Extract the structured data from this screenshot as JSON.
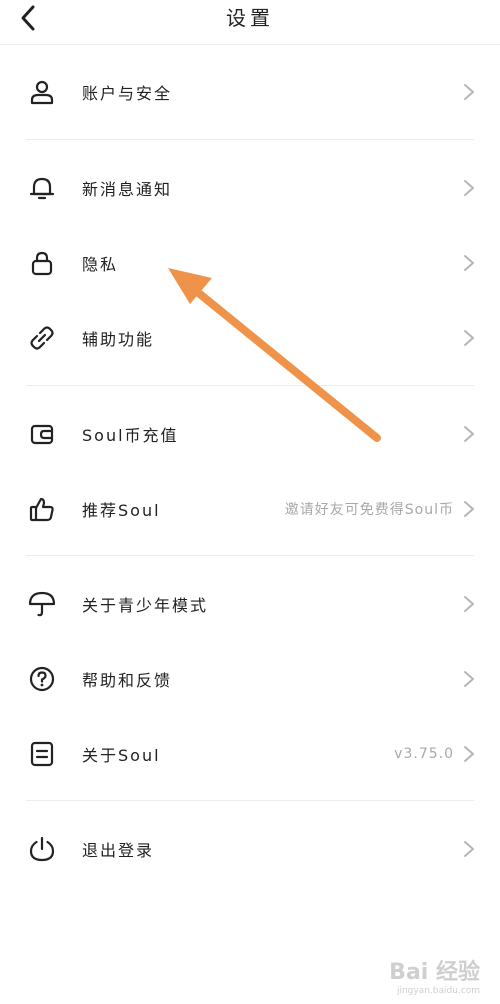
{
  "header": {
    "title": "设置",
    "back_icon": "chevron-left-icon"
  },
  "groups": [
    {
      "items": [
        {
          "label": "账户与安全",
          "icon": "user-icon",
          "hint": ""
        }
      ]
    },
    {
      "items": [
        {
          "label": "新消息通知",
          "icon": "bell-icon",
          "hint": ""
        },
        {
          "label": "隐私",
          "icon": "lock-icon",
          "hint": ""
        },
        {
          "label": "辅助功能",
          "icon": "link-icon",
          "hint": ""
        }
      ]
    },
    {
      "items": [
        {
          "label": "Soul币充值",
          "icon": "wallet-icon",
          "hint": ""
        },
        {
          "label": "推荐Soul",
          "icon": "thumbs-up-icon",
          "hint": "邀请好友可免费得Soul币"
        }
      ]
    },
    {
      "items": [
        {
          "label": "关于青少年模式",
          "icon": "umbrella-icon",
          "hint": ""
        },
        {
          "label": "帮助和反馈",
          "icon": "help-icon",
          "hint": ""
        },
        {
          "label": "关于Soul",
          "icon": "document-icon",
          "hint": "v3.75.0"
        }
      ]
    },
    {
      "items": [
        {
          "label": "退出登录",
          "icon": "power-icon",
          "hint": ""
        }
      ]
    }
  ],
  "colors": {
    "annotation_arrow": "#f0934a",
    "divider": "#ececec",
    "hint": "#a8a8a8"
  },
  "watermark": {
    "brand": "Bai 经验",
    "url": "jingyan.baidu.com"
  }
}
